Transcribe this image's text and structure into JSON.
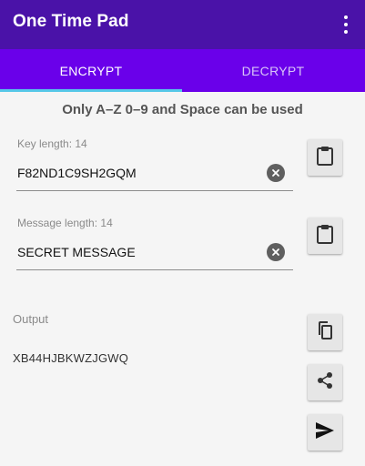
{
  "app": {
    "title": "One Time Pad",
    "overflow_icon": "more-vert-icon"
  },
  "tabs": [
    {
      "label": "ENCRYPT",
      "selected": true
    },
    {
      "label": "DECRYPT",
      "selected": false
    }
  ],
  "colors": {
    "app_bar": "#4a12a8",
    "tab_bar": "#6a00ea",
    "tab_indicator": "#56c8e8",
    "background": "#f5f5f5"
  },
  "rule_text": "Only A–Z 0–9 and Space can be used",
  "key_field": {
    "label": "Key length: 14",
    "value": "F82ND1C9SH2GQM",
    "clear_icon": "clear-circle-icon",
    "paste_icon": "clipboard-icon"
  },
  "message_field": {
    "label": "Message length: 14",
    "value": "SECRET MESSAGE",
    "clear_icon": "clear-circle-icon",
    "paste_icon": "clipboard-icon"
  },
  "output": {
    "label": "Output",
    "value": "XB44HJBKWZJGWQ",
    "copy_icon": "copy-icon",
    "share_icon": "share-icon",
    "send_icon": "send-icon"
  }
}
